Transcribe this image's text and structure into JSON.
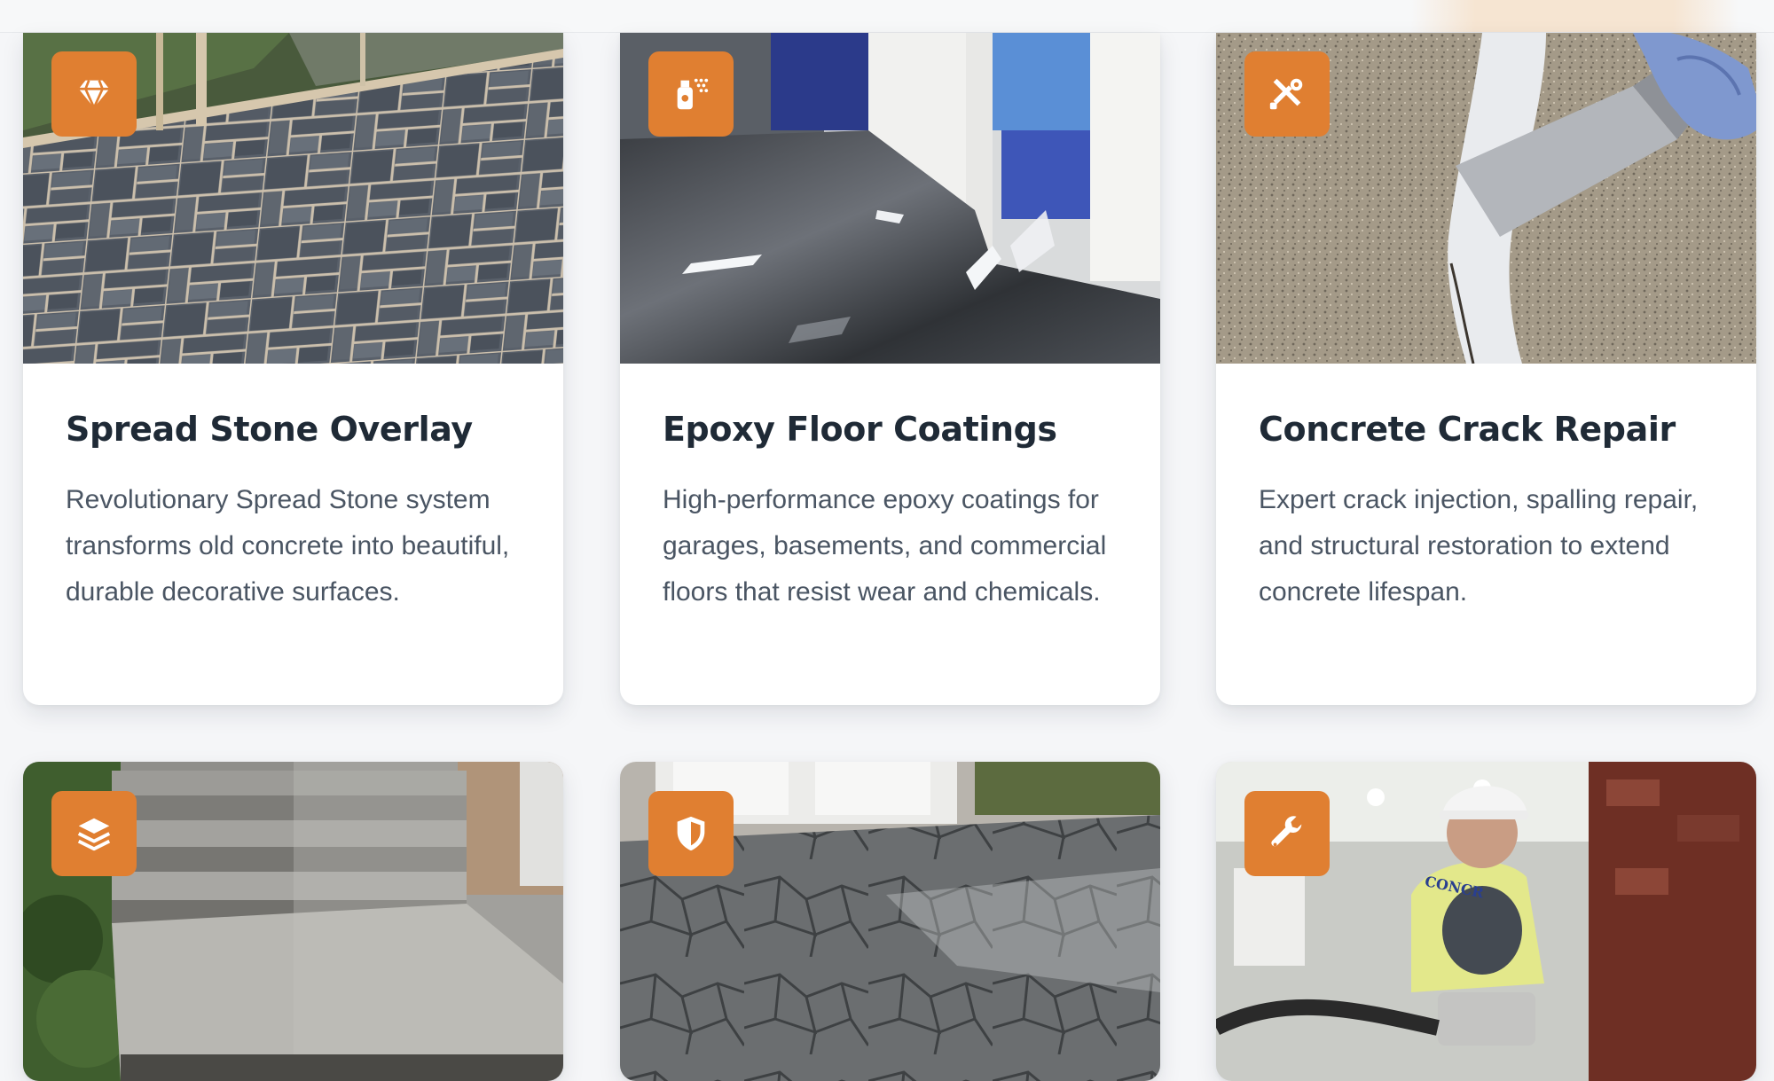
{
  "colors": {
    "accent": "#e07f31",
    "title": "#1f2a36",
    "text": "#4a5563",
    "card": "#ffffff",
    "page": "#f5f6f8"
  },
  "services": [
    {
      "icon": "gem-icon",
      "image": "stone-patio-photo",
      "title": "Spread Stone Overlay",
      "description": "Revolutionary Spread Stone system transforms old concrete into beautiful, durable decorative surfaces."
    },
    {
      "icon": "spray-can-icon",
      "image": "epoxy-floor-photo",
      "title": "Epoxy Floor Coatings",
      "description": "High-performance epoxy coatings for garages, basements, and commercial floors that resist wear and chemicals."
    },
    {
      "icon": "tools-icon",
      "image": "crack-repair-photo",
      "title": "Concrete Crack Repair",
      "description": "Expert crack injection, spalling repair, and structural restoration to extend concrete lifespan."
    },
    {
      "icon": "layers-icon",
      "image": "resurfaced-steps-photo"
    },
    {
      "icon": "shield-icon",
      "image": "stamped-patio-photo"
    },
    {
      "icon": "wrench-icon",
      "image": "worker-grinding-photo",
      "photo_text": "CONCR"
    }
  ]
}
